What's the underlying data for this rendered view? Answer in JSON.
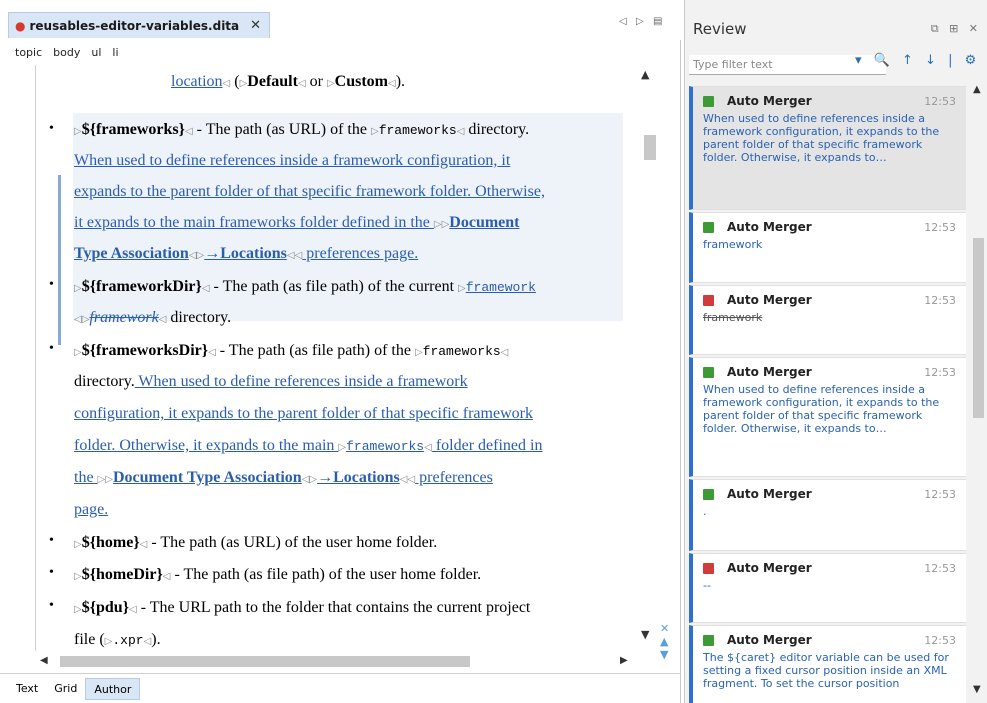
{
  "editor": {
    "tab_title": "reusables-editor-variables.dita",
    "tab_close": "✕",
    "tab_controls": [
      "◁",
      "▷",
      "▤"
    ],
    "breadcrumb": [
      "topic",
      "body",
      "ul",
      "li"
    ],
    "mode_tabs": [
      {
        "label": "Text"
      },
      {
        "label": "Grid"
      },
      {
        "label": "Author"
      }
    ],
    "active_mode": "Author"
  },
  "content": {
    "l0": {
      "ref": "location",
      "a": " (",
      "b": "Default",
      "c": " or ",
      "d": "Custom",
      "e": ")."
    },
    "fw": {
      "var": "${frameworks}",
      "t1": " - The path (as URL) of the ",
      "code": "frameworks",
      "t2": " directory.",
      "ins1": " When used to define references inside a framework configuration, it",
      "ins2": "expands to the parent folder of that specific framework folder. Otherwise,",
      "ins3": "it expands to the main frameworks folder defined in the ",
      "ins3b": "Document",
      "ins4a": "Type Association",
      "ins4b": "→Locations",
      "ins4c": " preferences page."
    },
    "fd": {
      "var": "${frameworkDir}",
      "t1": " - The path (as file path) of the current ",
      "ins": "framework",
      "del": "framework",
      "t2": " directory."
    },
    "fsd": {
      "var": "${frameworksDir}",
      "t1": " - The path (as file path) of the ",
      "code": "frameworks",
      "l2": "directory.",
      "ins1": " When used to define references inside a framework",
      "ins2": "configuration, it expands to the parent folder of that specific framework",
      "ins3a": "folder. Otherwise, it expands to the main ",
      "ins3code": "frameworks",
      "ins3b": " folder defined in",
      "ins4a": "the ",
      "ins4b": "Document Type Association",
      "ins4c": "→Locations",
      "ins4d": " preferences",
      "ins5": "page."
    },
    "home": {
      "var": "${home}",
      "t": " - The path (as URL) of the user home folder."
    },
    "homeDir": {
      "var": "${homeDir}",
      "t": " - The path (as file path) of the user home folder."
    },
    "pdu": {
      "var": "${pdu}",
      "t": " - The URL path to the folder that contains the current project",
      "l2": "file (",
      "code": ".xpr",
      "l2b": ")."
    }
  },
  "review": {
    "title": "Review",
    "controls": [
      "⧉",
      "⊞",
      "✕"
    ],
    "filter_placeholder": "Type filter text",
    "tools": [
      "▾",
      "🔍",
      "↑",
      "↓",
      "|",
      "⚙"
    ],
    "items": [
      {
        "type": "insert",
        "author": "Auto Merger",
        "time": "12:53",
        "text": "When used to define references inside a framework configuration, it expands to the parent folder of that specific framework folder. Otherwise, it expands to…",
        "selected": true
      },
      {
        "type": "insert",
        "author": "Auto Merger",
        "time": "12:53",
        "text": "framework"
      },
      {
        "type": "delete",
        "author": "Auto Merger",
        "time": "12:53",
        "text": "framework"
      },
      {
        "type": "insert",
        "author": "Auto Merger",
        "time": "12:53",
        "text": "When used to define references inside a framework configuration, it expands to the parent folder of that specific framework folder. Otherwise, it expands to…"
      },
      {
        "type": "insert",
        "author": "Auto Merger",
        "time": "12:53",
        "text": "."
      },
      {
        "type": "delete",
        "author": "Auto Merger",
        "time": "12:53",
        "text": "--"
      },
      {
        "type": "insert",
        "author": "Auto Merger",
        "time": "12:53",
        "text": "The ${caret} editor variable can be used for setting a fixed cursor position inside an XML fragment. To set the cursor position"
      }
    ]
  },
  "colors": {
    "accent": "#2e6fd0",
    "insert": "#3d9a35",
    "delete": "#d23b3b",
    "change_text": "#2a5db0"
  }
}
